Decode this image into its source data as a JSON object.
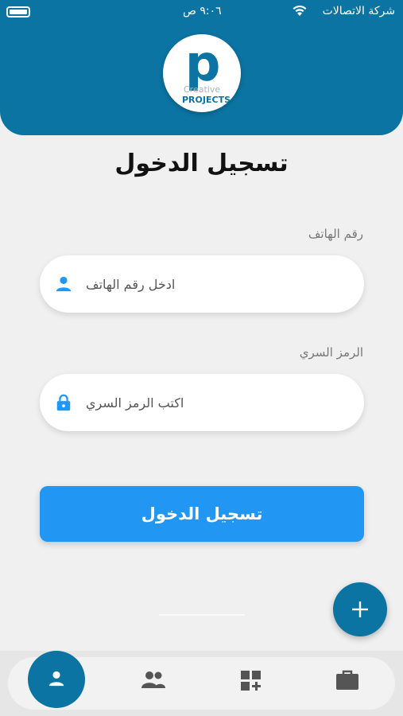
{
  "status_bar": {
    "carrier": "شركة الاتصالات",
    "time": "٩:٠٦ ص"
  },
  "logo": {
    "line1": "Creative",
    "line2": "PROJECTS"
  },
  "page_title": "تسجيل الدخول",
  "phone": {
    "label": "رقم الهاتف",
    "placeholder": "ادخل رقم الهاتف",
    "icon": "person-icon"
  },
  "password": {
    "label": "الرمز السري",
    "placeholder": "اكتب الرمز السري",
    "icon": "lock-icon"
  },
  "login_button": "تسجيل الدخول",
  "fab": {
    "icon": "plus-icon"
  },
  "bottom_nav": {
    "items": [
      {
        "icon": "person-icon",
        "active": true
      },
      {
        "icon": "group-icon",
        "active": false
      },
      {
        "icon": "dashboard-add-icon",
        "active": false
      },
      {
        "icon": "briefcase-icon",
        "active": false
      }
    ]
  },
  "colors": {
    "primary": "#0b74a3",
    "button": "#2196f3",
    "background": "#f0f0f0"
  }
}
